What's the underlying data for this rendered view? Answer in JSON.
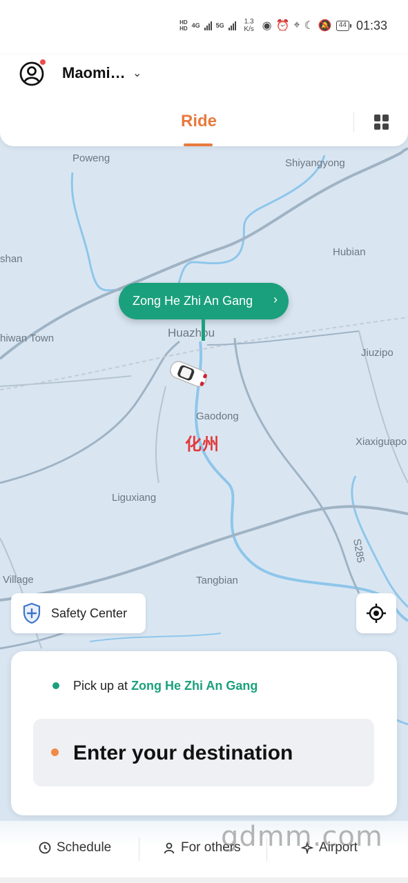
{
  "status_bar": {
    "hd1": "HD",
    "hd2": "HD",
    "net1": "4G",
    "net2": "5G",
    "speed_value": "1.3",
    "speed_unit": "K/s",
    "battery": "44",
    "time": "01:33",
    "icons": [
      "eye-icon",
      "alarm-icon",
      "location-icon",
      "moon-icon",
      "bell-off-icon"
    ]
  },
  "header": {
    "account_name": "Maomi…",
    "tab_label": "Ride"
  },
  "map": {
    "labels": {
      "poweng": "Poweng",
      "shiyangyong": "Shiyangyong",
      "shan": "shan",
      "hubian": "Hubian",
      "huazhou": "Huazhou",
      "hiwan_town": "hiwan Town",
      "jiuzipo": "Jiuzipo",
      "gaodong": "Gaodong",
      "city_name": "化州",
      "xiaxiguapo": "Xiaxiguapo",
      "liguxiang": "Liguxiang",
      "s285": "S285",
      "village": "Village",
      "tangbian": "Tangbian"
    }
  },
  "pickup_pin": {
    "label": "Zong He Zhi An Gang",
    "color": "#1aa07c"
  },
  "safety_center": {
    "label": "Safety Center"
  },
  "ride_card": {
    "pickup_prefix": "Pick up at",
    "pickup_location": "Zong He Zhi An Gang",
    "destination_placeholder": "Enter your destination",
    "accent_pickup": "#1aa07c",
    "accent_destination": "#f08a47"
  },
  "bottom_bar": {
    "schedule": "Schedule",
    "for_others": "For others",
    "airport": "Airport"
  },
  "watermark": "gdmm.com",
  "colors": {
    "brand_orange": "#e87a3e",
    "green": "#1aa07c"
  }
}
